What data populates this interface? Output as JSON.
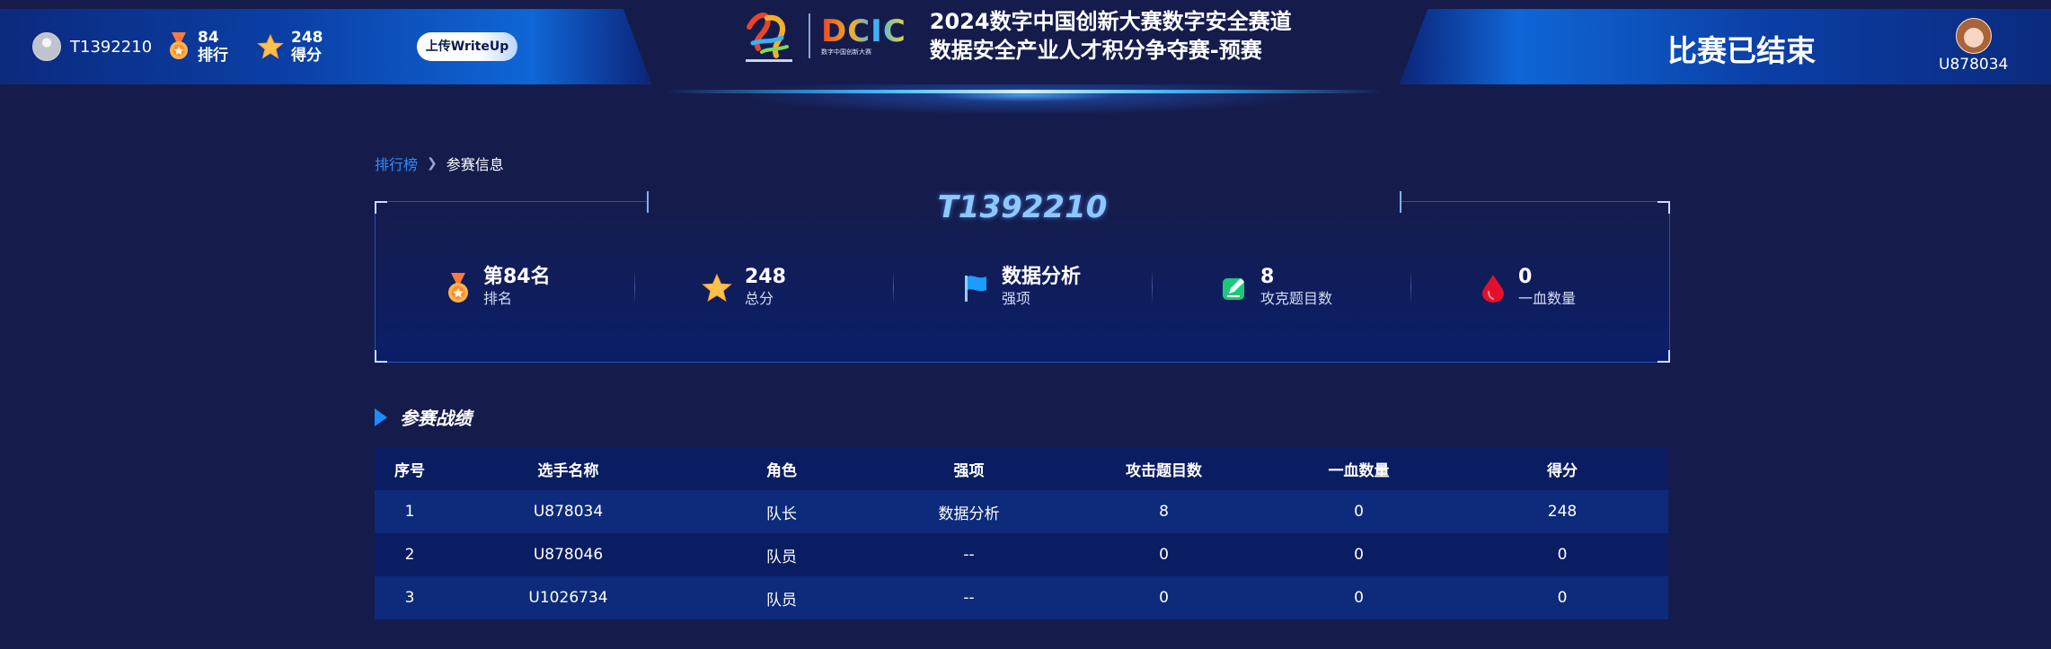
{
  "header": {
    "team_id": "T1392210",
    "rank_value": "84",
    "rank_label": "排行",
    "score_value": "248",
    "score_label": "得分",
    "upload_label": "上传WriteUp",
    "logo_text": "DCIC",
    "logo_subtext": "数字中国创新大赛",
    "title_line1": "2024数字中国创新大赛数字安全赛道",
    "title_line2": "数据安全产业人才积分争夺赛-预赛",
    "status": "比赛已结束",
    "user": "U878034"
  },
  "breadcrumb": {
    "parent": "排行榜",
    "current": "参赛信息"
  },
  "team_card": {
    "name": "T1392210",
    "stats": [
      {
        "icon": "medal-icon",
        "value": "第84名",
        "label": "排名"
      },
      {
        "icon": "star-icon",
        "value": "248",
        "label": "总分"
      },
      {
        "icon": "flag-icon",
        "value": "数据分析",
        "label": "强项"
      },
      {
        "icon": "edit-icon",
        "value": "8",
        "label": "攻克题目数"
      },
      {
        "icon": "blood-drop-icon",
        "value": "0",
        "label": "一血数量"
      }
    ]
  },
  "section": {
    "title": "参赛战绩"
  },
  "table": {
    "headers": [
      "序号",
      "选手名称",
      "角色",
      "强项",
      "攻击题目数",
      "一血数量",
      "得分"
    ],
    "rows": [
      [
        "1",
        "U878034",
        "队长",
        "数据分析",
        "8",
        "0",
        "248"
      ],
      [
        "2",
        "U878046",
        "队员",
        "--",
        "0",
        "0",
        "0"
      ],
      [
        "3",
        "U1026734",
        "队员",
        "--",
        "0",
        "0",
        "0"
      ]
    ]
  },
  "colors": {
    "background": "#151c4c",
    "accent": "#1e8cff",
    "link": "#2f8cff",
    "team_name": "#8ec8ff",
    "row_odd": "#0d2b7a",
    "row_even": "#0a1d62"
  }
}
